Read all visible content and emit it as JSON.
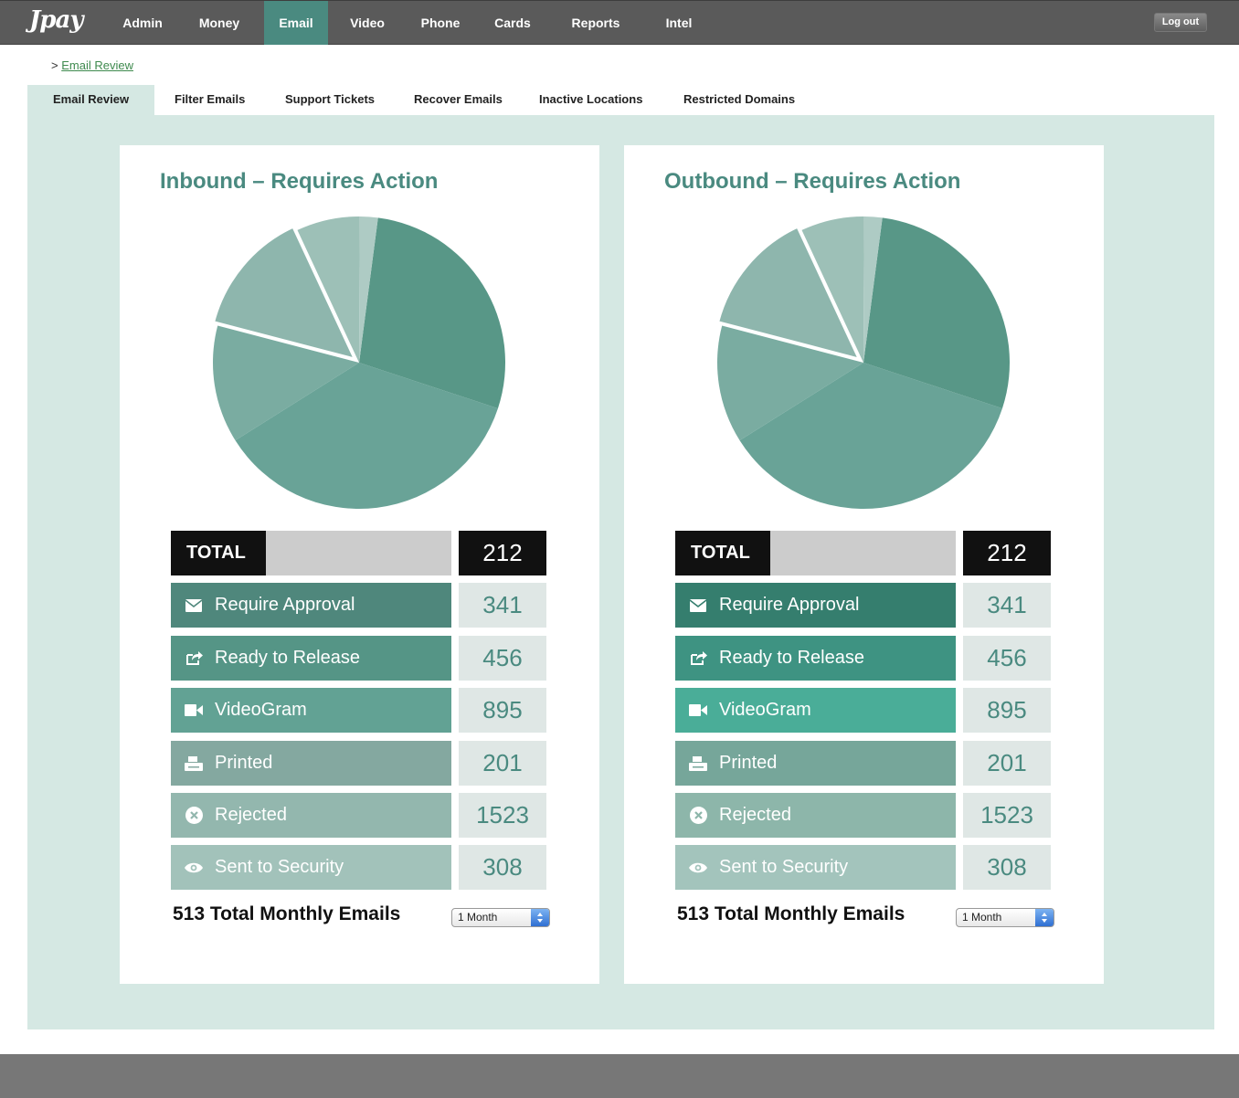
{
  "app": {
    "logo": "Jpay",
    "nav": [
      "Admin",
      "Money",
      "Email",
      "Video",
      "Phone",
      "Cards",
      "Reports",
      "Intel"
    ],
    "active_nav": "Email",
    "logout_label": "Log out"
  },
  "breadcrumb": {
    "prefix": ">",
    "link": "Email Review"
  },
  "subtabs": [
    "Email Review",
    "Filter Emails",
    "Support Tickets",
    "Recover Emails",
    "Inactive Locations",
    "Restricted Domains"
  ],
  "panels": [
    {
      "title": "Inbound – Requires Action",
      "total_label": "TOTAL",
      "total_value": "212",
      "rows": [
        {
          "label": "Require Approval",
          "value": "341",
          "icon": "envelope-icon",
          "color": "#4f877c"
        },
        {
          "label": "Ready to Release",
          "value": "456",
          "icon": "share-icon",
          "color": "#559586"
        },
        {
          "label": "VideoGram",
          "value": "895",
          "icon": "video-camera-icon",
          "color": "#62a294"
        },
        {
          "label": "Printed",
          "value": "201",
          "icon": "printer-icon",
          "color": "#84a8a0"
        },
        {
          "label": "Rejected",
          "value": "1523",
          "icon": "reject-circle-icon",
          "color": "#93b7ae"
        },
        {
          "label": "Sent to Security",
          "value": "308",
          "icon": "eye-icon",
          "color": "#a2c2ba"
        }
      ],
      "monthly_text": "513 Total Monthly Emails",
      "period": "1 Month"
    },
    {
      "title": "Outbound – Requires Action",
      "total_label": "TOTAL",
      "total_value": "212",
      "rows": [
        {
          "label": "Require Approval",
          "value": "341",
          "icon": "envelope-icon",
          "color": "#357e6e"
        },
        {
          "label": "Ready to Release",
          "value": "456",
          "icon": "share-icon",
          "color": "#3e9382"
        },
        {
          "label": "VideoGram",
          "value": "895",
          "icon": "video-camera-icon",
          "color": "#4aad98"
        },
        {
          "label": "Printed",
          "value": "201",
          "icon": "printer-icon",
          "color": "#76a69a"
        },
        {
          "label": "Rejected",
          "value": "1523",
          "icon": "reject-circle-icon",
          "color": "#8db6aa"
        },
        {
          "label": "Sent to Security",
          "value": "308",
          "icon": "eye-icon",
          "color": "#a3c4bc"
        }
      ],
      "monthly_text": "513 Total Monthly Emails",
      "period": "1 Month"
    }
  ],
  "chart_data": [
    {
      "type": "pie",
      "title": "Inbound – Requires Action",
      "categories": [
        "Ready to Release",
        "VideoGram",
        "Printed",
        "Require Approval",
        "Rejected",
        "Sent to Security"
      ],
      "values": [
        28,
        36,
        13,
        14,
        7,
        2
      ],
      "colors": [
        "#589787",
        "#69a397",
        "#7aaca1",
        "#8eb6ad",
        "#9dc0b7",
        "#aecbc4"
      ]
    },
    {
      "type": "pie",
      "title": "Outbound – Requires Action",
      "categories": [
        "Ready to Release",
        "VideoGram",
        "Printed",
        "Require Approval",
        "Rejected",
        "Sent to Security"
      ],
      "values": [
        28,
        36,
        13,
        14,
        7,
        2
      ],
      "colors": [
        "#589787",
        "#69a397",
        "#7aaca1",
        "#8eb6ad",
        "#9dc0b7",
        "#aecbc4"
      ]
    }
  ]
}
